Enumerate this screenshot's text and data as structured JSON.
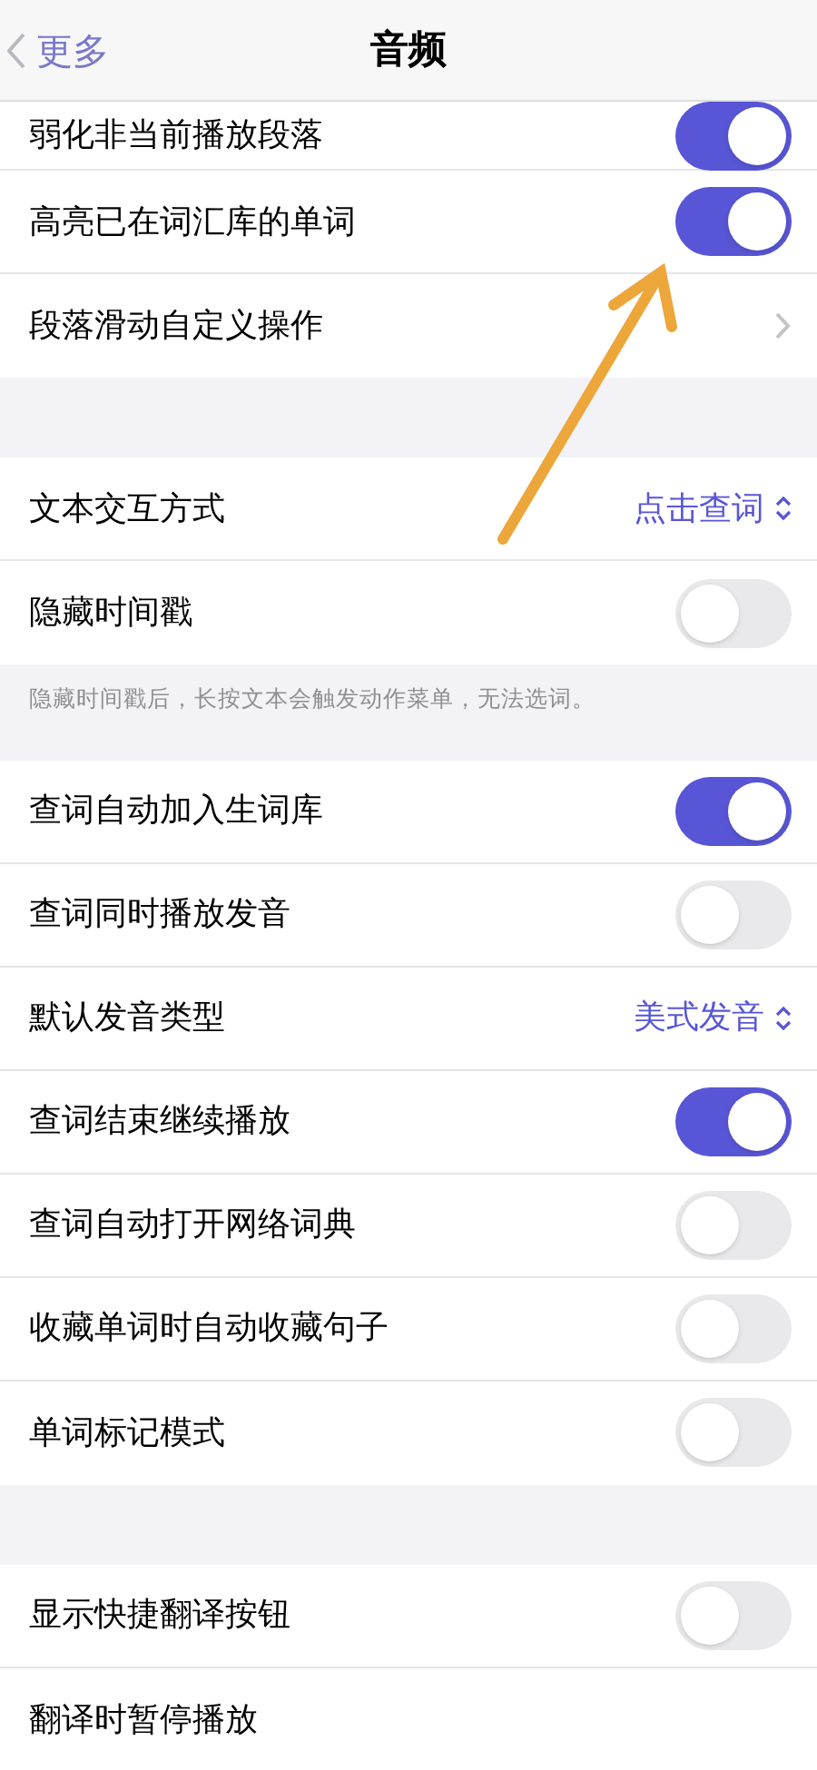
{
  "nav": {
    "back": "更多",
    "title": "音频"
  },
  "groups": [
    {
      "rows": [
        {
          "kind": "toggle",
          "label": "弱化非当前播放段落",
          "on": true
        },
        {
          "kind": "toggle",
          "label": "高亮已在词汇库的单词",
          "on": true
        },
        {
          "kind": "disclosure",
          "label": "段落滑动自定义操作"
        }
      ]
    },
    {
      "rows": [
        {
          "kind": "picker",
          "label": "文本交互方式",
          "value": "点击查词"
        },
        {
          "kind": "toggle",
          "label": "隐藏时间戳",
          "on": false
        }
      ],
      "footer": "隐藏时间戳后，长按文本会触发动作菜单，无法选词。"
    },
    {
      "rows": [
        {
          "kind": "toggle",
          "label": "查词自动加入生词库",
          "on": true
        },
        {
          "kind": "toggle",
          "label": "查词同时播放发音",
          "on": false
        },
        {
          "kind": "picker",
          "label": "默认发音类型",
          "value": "美式发音"
        },
        {
          "kind": "toggle",
          "label": "查词结束继续播放",
          "on": true
        },
        {
          "kind": "toggle",
          "label": "查词自动打开网络词典",
          "on": false
        },
        {
          "kind": "toggle",
          "label": "收藏单词时自动收藏句子",
          "on": false
        },
        {
          "kind": "toggle",
          "label": "单词标记模式",
          "on": false
        }
      ]
    },
    {
      "rows": [
        {
          "kind": "toggle",
          "label": "显示快捷翻译按钮",
          "on": false
        },
        {
          "kind": "plain",
          "label": "翻译时暂停播放"
        }
      ]
    }
  ]
}
